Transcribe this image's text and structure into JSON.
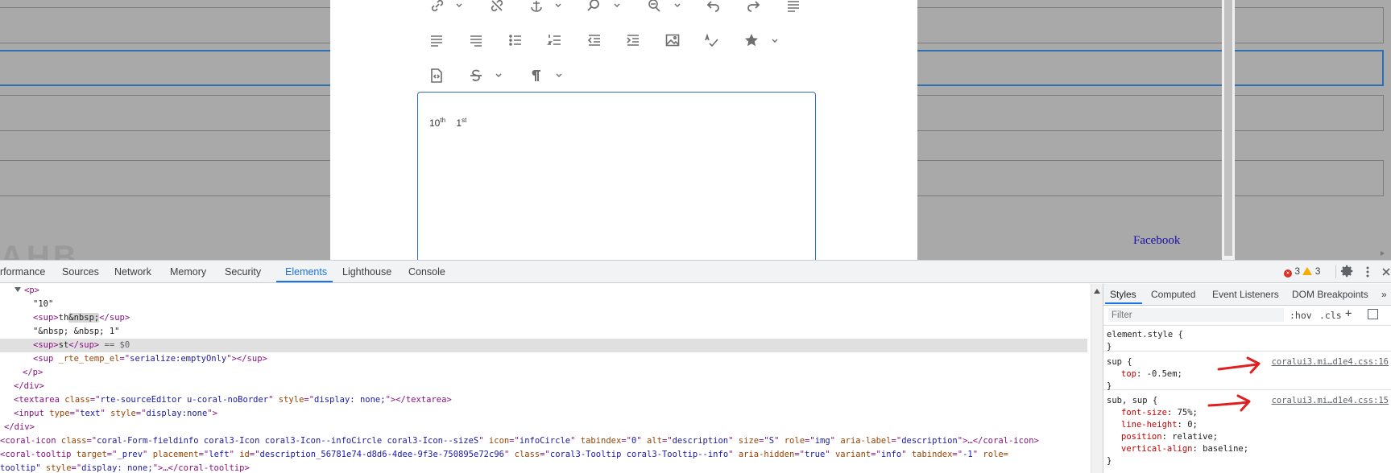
{
  "page": {
    "background_link": "Facebook",
    "background_logo": "AHB",
    "colors": {
      "overlay": "#a9a9a9",
      "focus_border": "#2f6fb3",
      "accent": "#1a73e8",
      "annotation": "#e02020"
    }
  },
  "rte": {
    "toolbar": {
      "row1": [
        "link-icon",
        "unlink-icon",
        "anchor-icon",
        "find-icon",
        "replace-icon",
        "undo-icon",
        "redo-icon",
        "paragraph-format-icon"
      ],
      "row2": [
        "align-left-icon",
        "align-right-icon",
        "bulleted-list-icon",
        "numbered-list-icon",
        "outdent-icon",
        "indent-icon",
        "image-icon",
        "spellcheck-icon",
        "star-icon"
      ],
      "row3": [
        "source-edit-icon",
        "strikethrough-style-icon",
        "pilcrow-icon"
      ]
    },
    "content": {
      "a_base": "10",
      "a_sup": "th",
      "b_base": "1",
      "b_sup": "st"
    }
  },
  "devtools": {
    "tabs": [
      "rformance",
      "Sources",
      "Network",
      "Memory",
      "Security",
      "Elements",
      "Lighthouse",
      "Console"
    ],
    "active_tab": "Elements",
    "errors": "3",
    "warnings": "3",
    "dom": {
      "l1_tag": "p",
      "l2": "\"10\"",
      "l3_tag": "sup",
      "l3_text": "th",
      "l3_entity": "&nbsp;",
      "l4": "\"&nbsp; &nbsp; 1\"",
      "l5_tag": "sup",
      "l5_text": "st",
      "l5_marker": " == $0",
      "l6_tag": "sup",
      "l6_attr": "_rte_temp_el",
      "l6_val": "serialize:emptyOnly",
      "l7": "</p>",
      "l8": "</div>",
      "l9_tag": "textarea",
      "l9_a1": "class",
      "l9_v1": "rte-sourceEditor u-coral-noBorder",
      "l9_a2": "style",
      "l9_v2": "display: none;",
      "l10_tag": "input",
      "l10_a1": "type",
      "l10_v1": "text",
      "l10_a2": "style",
      "l10_v2": "display:none",
      "l11": "</div>",
      "l12_tag": "coral-icon",
      "l12_attrs": [
        [
          "class",
          "coral-Form-fieldinfo coral3-Icon coral3-Icon--infoCircle coral3-Icon--sizeS"
        ],
        [
          "icon",
          "infoCircle"
        ],
        [
          "tabindex",
          "0"
        ],
        [
          "alt",
          "description"
        ],
        [
          "size",
          "S"
        ],
        [
          "role",
          "img"
        ],
        [
          "aria-label",
          "description"
        ]
      ],
      "l12_end": "…</coral-icon>",
      "l13_tag": "coral-tooltip",
      "l13_attrs": [
        [
          "target",
          "_prev"
        ],
        [
          "placement",
          "left"
        ],
        [
          "id",
          "description_56781e74-d8d6-4dee-9f3e-750895e72c96"
        ],
        [
          "class",
          "coral3-Tooltip coral3-Tooltip--info"
        ],
        [
          "aria-hidden",
          "true"
        ],
        [
          "variant",
          "info"
        ],
        [
          "tabindex",
          "-1"
        ]
      ],
      "l13_role": "role=",
      "l14_pre": "tooltip\"",
      "l14_attr": "style",
      "l14_val": "display: none;",
      "l14_end": "…</coral-tooltip>"
    },
    "styles": {
      "tabs": [
        "Styles",
        "Computed",
        "Event Listeners",
        "DOM Breakpoints"
      ],
      "filter_placeholder": "Filter",
      "hov": ":hov",
      "cls": ".cls",
      "element_style": "element.style {",
      "rule1": {
        "selector": "sup {",
        "source": "coralui3.mi…d1e4.css:16",
        "prop": "top",
        "value": "-0.5em;"
      },
      "rule2": {
        "selector": "sub, sup {",
        "source": "coralui3.mi…d1e4.css:15",
        "props": [
          [
            "font-size",
            "75%;"
          ],
          [
            "line-height",
            "0;"
          ],
          [
            "position",
            "relative;"
          ],
          [
            "vertical-align",
            "baseline;"
          ]
        ]
      }
    }
  }
}
